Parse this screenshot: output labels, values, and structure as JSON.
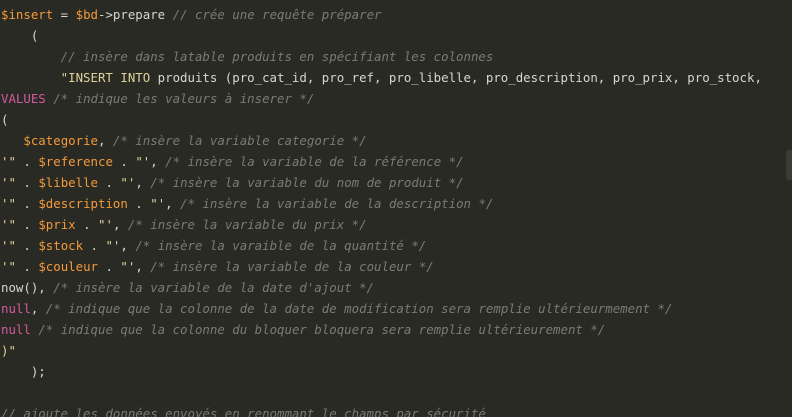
{
  "editor": {
    "lines": [
      [
        {
          "t": "var",
          "v": "$insert"
        },
        {
          "t": "plain",
          "v": " = "
        },
        {
          "t": "var",
          "v": "$bd"
        },
        {
          "t": "plain",
          "v": "->prepare "
        },
        {
          "t": "cmt",
          "v": "// crée une requête préparer"
        }
      ],
      [
        {
          "t": "plain",
          "v": "    ("
        }
      ],
      [
        {
          "t": "cmt",
          "v": "        // insère dans latable produits en spécifiant les colonnes"
        }
      ],
      [
        {
          "t": "str",
          "v": "        \"INSERT INTO "
        },
        {
          "t": "plain",
          "v": "produits (pro_cat_id, pro_ref, pro_libelle, pro_description, pro_prix, pro_stock,"
        }
      ],
      [
        {
          "t": "kw",
          "v": "VALUES"
        },
        {
          "t": "cmt",
          "v": " /* indique les valeurs à inserer */"
        }
      ],
      [
        {
          "t": "plain",
          "v": "("
        }
      ],
      [
        {
          "t": "plain",
          "v": "   "
        },
        {
          "t": "var",
          "v": "$categorie"
        },
        {
          "t": "plain",
          "v": ", "
        },
        {
          "t": "cmt",
          "v": "/* insère la variable categorie */"
        }
      ],
      [
        {
          "t": "str",
          "v": "'\""
        },
        {
          "t": "plain",
          "v": " . "
        },
        {
          "t": "var",
          "v": "$reference"
        },
        {
          "t": "plain",
          "v": " . "
        },
        {
          "t": "str",
          "v": "\"'"
        },
        {
          "t": "plain",
          "v": ", "
        },
        {
          "t": "cmt",
          "v": "/* insère la variable de la référence */"
        }
      ],
      [
        {
          "t": "str",
          "v": "'\""
        },
        {
          "t": "plain",
          "v": " . "
        },
        {
          "t": "var",
          "v": "$libelle"
        },
        {
          "t": "plain",
          "v": " . "
        },
        {
          "t": "str",
          "v": "\"'"
        },
        {
          "t": "plain",
          "v": ", "
        },
        {
          "t": "cmt",
          "v": "/* insère la variable du nom de produit */"
        }
      ],
      [
        {
          "t": "str",
          "v": "'\""
        },
        {
          "t": "plain",
          "v": " . "
        },
        {
          "t": "var",
          "v": "$description"
        },
        {
          "t": "plain",
          "v": " . "
        },
        {
          "t": "str",
          "v": "\"'"
        },
        {
          "t": "plain",
          "v": ", "
        },
        {
          "t": "cmt",
          "v": "/* insère la variable de la description */"
        }
      ],
      [
        {
          "t": "str",
          "v": "'\""
        },
        {
          "t": "plain",
          "v": " . "
        },
        {
          "t": "var",
          "v": "$prix"
        },
        {
          "t": "plain",
          "v": " . "
        },
        {
          "t": "str",
          "v": "\"'"
        },
        {
          "t": "plain",
          "v": ", "
        },
        {
          "t": "cmt",
          "v": "/* insère la variable du prix */"
        }
      ],
      [
        {
          "t": "str",
          "v": "'\""
        },
        {
          "t": "plain",
          "v": " . "
        },
        {
          "t": "var",
          "v": "$stock"
        },
        {
          "t": "plain",
          "v": " . "
        },
        {
          "t": "str",
          "v": "\"'"
        },
        {
          "t": "plain",
          "v": ", "
        },
        {
          "t": "cmt",
          "v": "/* insère la varaible de la quantité */"
        }
      ],
      [
        {
          "t": "str",
          "v": "'\""
        },
        {
          "t": "plain",
          "v": " . "
        },
        {
          "t": "var",
          "v": "$couleur"
        },
        {
          "t": "plain",
          "v": " . "
        },
        {
          "t": "str",
          "v": "\"'"
        },
        {
          "t": "plain",
          "v": ", "
        },
        {
          "t": "cmt",
          "v": "/* insère la variable de la couleur */"
        }
      ],
      [
        {
          "t": "plain",
          "v": "now(), "
        },
        {
          "t": "cmt",
          "v": "/* insère la variable de la date d'ajout */"
        }
      ],
      [
        {
          "t": "kw",
          "v": "null"
        },
        {
          "t": "plain",
          "v": ", "
        },
        {
          "t": "cmt",
          "v": "/* indique que la colonne de la date de modification sera remplie ultérieurmement */"
        }
      ],
      [
        {
          "t": "kw",
          "v": "null"
        },
        {
          "t": "plain",
          "v": " "
        },
        {
          "t": "cmt",
          "v": "/* indique que la colonne du bloquer bloquera sera remplie ultérieurement */"
        }
      ],
      [
        {
          "t": "str",
          "v": ")\""
        }
      ],
      [
        {
          "t": "plain",
          "v": "    );"
        }
      ],
      [
        {
          "t": "plain",
          "v": ""
        }
      ],
      [
        {
          "t": "cmt",
          "v": "// ajoute les données envoyés en renommant le champs par sécurité"
        }
      ]
    ]
  }
}
